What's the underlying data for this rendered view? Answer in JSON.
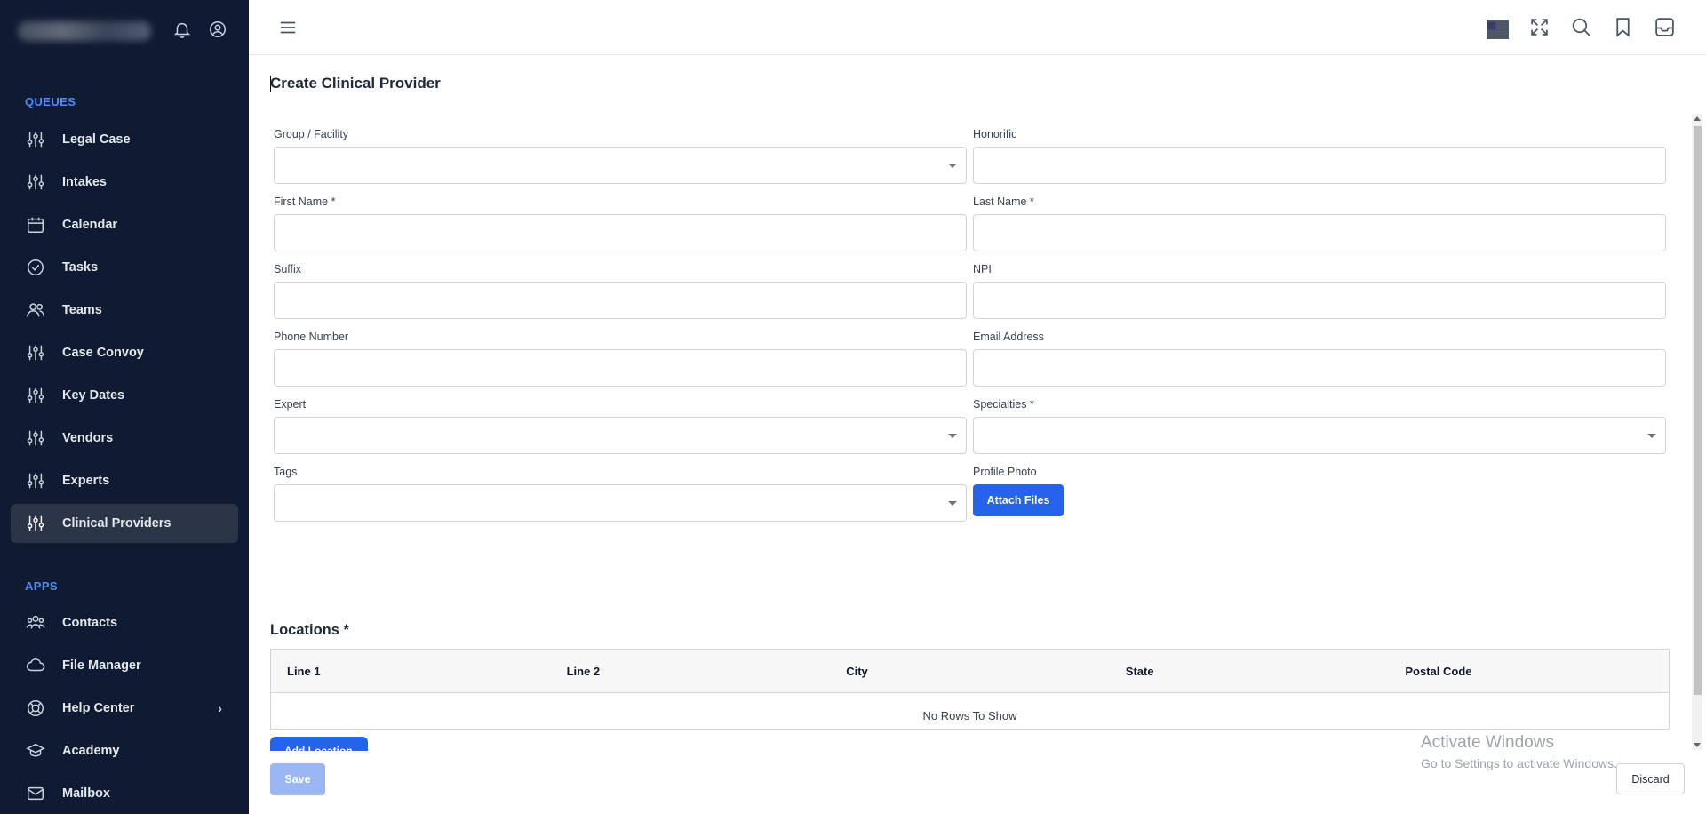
{
  "sidebar": {
    "sections": {
      "queues": "QUEUES",
      "apps": "APPS"
    },
    "queues": [
      {
        "label": "Legal Case",
        "icon": "sliders-icon"
      },
      {
        "label": "Intakes",
        "icon": "sliders-icon"
      },
      {
        "label": "Calendar",
        "icon": "calendar-icon"
      },
      {
        "label": "Tasks",
        "icon": "check-circle-icon"
      },
      {
        "label": "Teams",
        "icon": "users-icon"
      },
      {
        "label": "Case Convoy",
        "icon": "sliders-icon"
      },
      {
        "label": "Key Dates",
        "icon": "sliders-icon"
      },
      {
        "label": "Vendors",
        "icon": "sliders-icon"
      },
      {
        "label": "Experts",
        "icon": "sliders-icon"
      },
      {
        "label": "Clinical Providers",
        "icon": "sliders-icon",
        "active": true
      }
    ],
    "apps": [
      {
        "label": "Contacts",
        "icon": "contacts-icon"
      },
      {
        "label": "File Manager",
        "icon": "cloud-icon"
      },
      {
        "label": "Help Center",
        "icon": "lifebuoy-icon",
        "has_submenu": true
      },
      {
        "label": "Academy",
        "icon": "graduation-cap-icon"
      },
      {
        "label": "Mailbox",
        "icon": "mail-icon"
      }
    ]
  },
  "topbar": {
    "icons": [
      "us-flag-icon",
      "fullscreen-icon",
      "search-icon",
      "bookmark-icon",
      "inbox-icon"
    ]
  },
  "page": {
    "title": "Create Clinical Provider"
  },
  "form": {
    "group_facility": {
      "label": "Group / Facility",
      "value": ""
    },
    "honorific": {
      "label": "Honorific",
      "value": ""
    },
    "first_name": {
      "label": "First Name *",
      "value": ""
    },
    "last_name": {
      "label": "Last Name *",
      "value": ""
    },
    "suffix": {
      "label": "Suffix",
      "value": ""
    },
    "npi": {
      "label": "NPI",
      "value": ""
    },
    "phone": {
      "label": "Phone Number",
      "value": ""
    },
    "email": {
      "label": "Email Address",
      "value": ""
    },
    "expert": {
      "label": "Expert",
      "value": ""
    },
    "specialties": {
      "label": "Specialties *",
      "value": ""
    },
    "tags": {
      "label": "Tags",
      "value": ""
    },
    "profile_photo": {
      "label": "Profile Photo",
      "button": "Attach Files"
    }
  },
  "locations": {
    "title": "Locations *",
    "columns": [
      "Line 1",
      "Line 2",
      "City",
      "State",
      "Postal Code"
    ],
    "empty_text": "No Rows To Show",
    "add_button": "Add Location"
  },
  "actions": {
    "save": "Save",
    "discard": "Discard"
  },
  "watermark": {
    "line1": "Activate Windows",
    "line2": "Go to Settings to activate Windows."
  },
  "colors": {
    "sidebar_bg": "#0f1b33",
    "accent": "#2563eb",
    "section_label": "#4c8dff"
  }
}
